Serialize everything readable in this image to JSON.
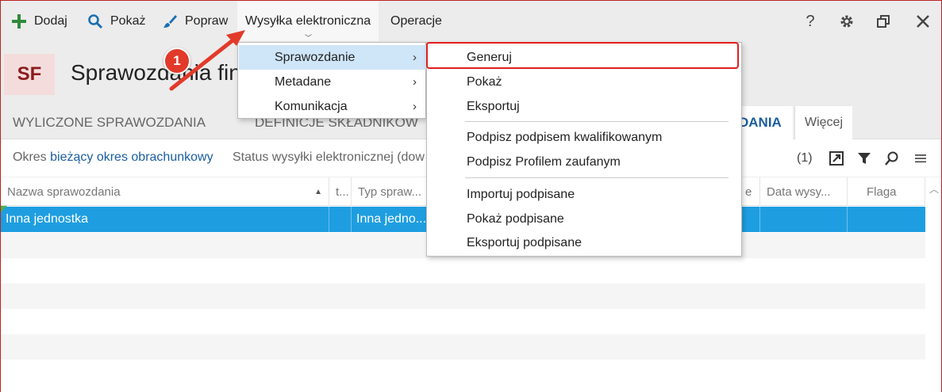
{
  "toolbar": {
    "add_label": "Dodaj",
    "show_label": "Pokaż",
    "edit_label": "Popraw",
    "esend_label": "Wysyłka elektroniczna",
    "ops_label": "Operacje",
    "help_label": "?"
  },
  "header": {
    "badge": "SF",
    "title": "Sprawozdania fin"
  },
  "tabs": {
    "t1": "WYLICZONE SPRAWOZDANIA",
    "t2": "DEFINICJE SKŁADNIKOW",
    "t3": "DANIA",
    "more": "Więcej"
  },
  "filters": {
    "period_label": "Okres",
    "period_value": "bieżący okres obrachunkowy",
    "status_label": "Status wysyłki elektronicznej (dow",
    "count": "(1)"
  },
  "grid": {
    "headers": {
      "name": "Nazwa sprawozdania",
      "t": "t...",
      "type": "Typ spraw...",
      "e": "e",
      "date": "Data wysy...",
      "flag": "Flaga"
    },
    "rows": [
      {
        "name": "Inna jednostka",
        "type": "Inna jedno..."
      }
    ]
  },
  "menu1": {
    "items": [
      {
        "label": "Sprawozdanie",
        "arrow": "›"
      },
      {
        "label": "Metadane",
        "arrow": "›"
      },
      {
        "label": "Komunikacja",
        "arrow": "›"
      }
    ]
  },
  "menu2": {
    "items": [
      "Generuj",
      "Pokaż",
      "Eksportuj",
      "Podpisz podpisem kwalifikowanym",
      "Podpisz Profilem zaufanym",
      "Importuj podpisane",
      "Pokaż podpisane",
      "Eksportuj podpisane"
    ]
  },
  "annotation": {
    "step": "1"
  },
  "colors": {
    "accent": "#1a5d9e",
    "selection": "#1e9ee0",
    "highlight": "#e02020",
    "add_icon": "#2e8b3a",
    "show_icon": "#1a6fb0"
  },
  "icons": [
    "plus-icon",
    "search-icon",
    "brush-icon",
    "help-icon",
    "gear-icon",
    "restore-icon",
    "close-icon",
    "export-icon",
    "filter-icon",
    "search-icon",
    "menu-icon"
  ]
}
